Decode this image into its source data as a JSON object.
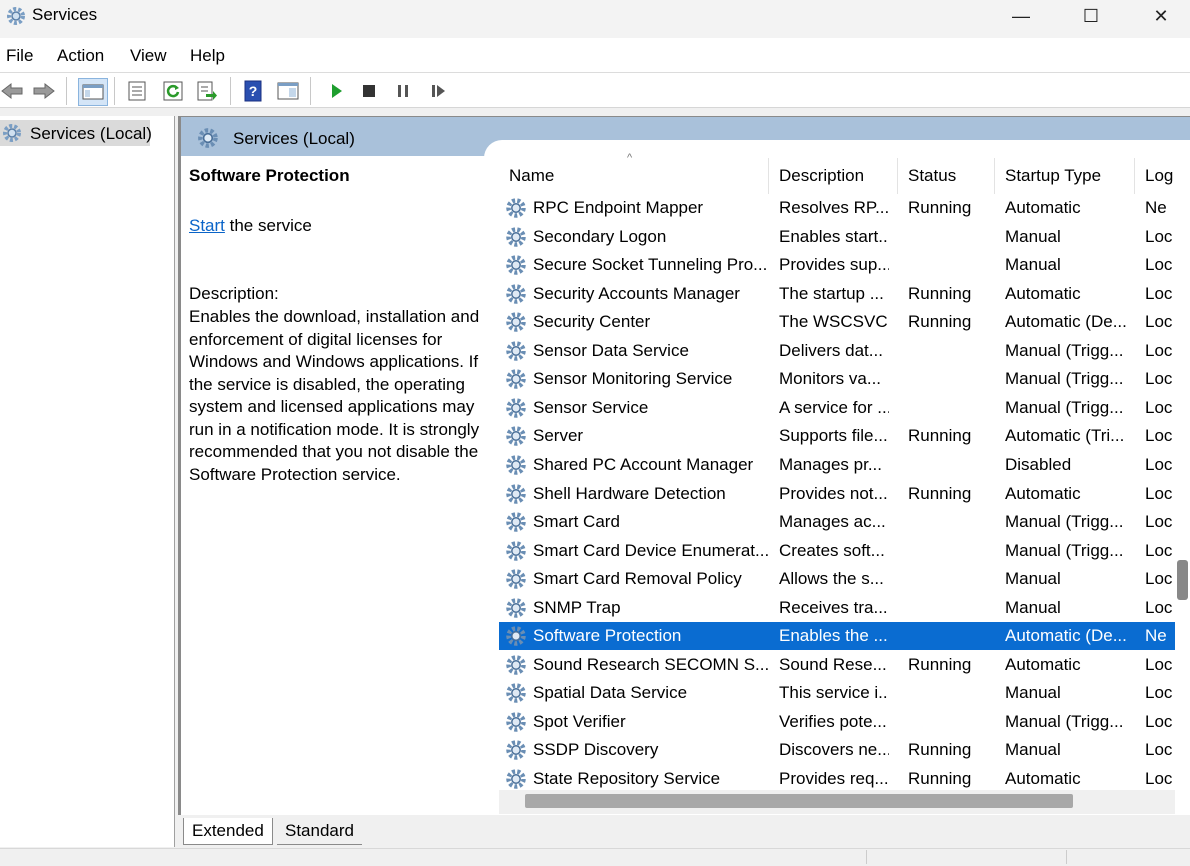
{
  "window": {
    "title": "Services",
    "minimize": "—",
    "maximize": "☐",
    "close": "✕"
  },
  "menu": [
    "File",
    "Action",
    "View",
    "Help"
  ],
  "tree": {
    "item": "Services (Local)"
  },
  "main": {
    "header_title": "Services (Local)"
  },
  "details": {
    "service_name": "Software Protection",
    "start_link": "Start",
    "start_suffix": " the service",
    "description_label": "Description:",
    "description": "Enables the download, installation and enforcement of digital licenses for Windows and Windows applications. If the service is disabled, the operating system and licensed applications may run in a notification mode. It is strongly recommended that you not disable the Software Protection service."
  },
  "columns": [
    "Name",
    "Description",
    "Status",
    "Startup Type",
    "Log"
  ],
  "services": [
    {
      "name": "RPC Endpoint Mapper",
      "description": "Resolves RP...",
      "status": "Running",
      "startup": "Automatic",
      "logon": "Ne"
    },
    {
      "name": "Secondary Logon",
      "description": "Enables start...",
      "status": "",
      "startup": "Manual",
      "logon": "Loc"
    },
    {
      "name": "Secure Socket Tunneling Pro...",
      "description": "Provides sup...",
      "status": "",
      "startup": "Manual",
      "logon": "Loc"
    },
    {
      "name": "Security Accounts Manager",
      "description": "The startup ...",
      "status": "Running",
      "startup": "Automatic",
      "logon": "Loc"
    },
    {
      "name": "Security Center",
      "description": "The WSCSVC...",
      "status": "Running",
      "startup": "Automatic (De...",
      "logon": "Loc"
    },
    {
      "name": "Sensor Data Service",
      "description": "Delivers dat...",
      "status": "",
      "startup": "Manual (Trigg...",
      "logon": "Loc"
    },
    {
      "name": "Sensor Monitoring Service",
      "description": "Monitors va...",
      "status": "",
      "startup": "Manual (Trigg...",
      "logon": "Loc"
    },
    {
      "name": "Sensor Service",
      "description": "A service for ...",
      "status": "",
      "startup": "Manual (Trigg...",
      "logon": "Loc"
    },
    {
      "name": "Server",
      "description": "Supports file...",
      "status": "Running",
      "startup": "Automatic (Tri...",
      "logon": "Loc"
    },
    {
      "name": "Shared PC Account Manager",
      "description": "Manages pr...",
      "status": "",
      "startup": "Disabled",
      "logon": "Loc"
    },
    {
      "name": "Shell Hardware Detection",
      "description": "Provides not...",
      "status": "Running",
      "startup": "Automatic",
      "logon": "Loc"
    },
    {
      "name": "Smart Card",
      "description": "Manages ac...",
      "status": "",
      "startup": "Manual (Trigg...",
      "logon": "Loc"
    },
    {
      "name": "Smart Card Device Enumerat...",
      "description": "Creates soft...",
      "status": "",
      "startup": "Manual (Trigg...",
      "logon": "Loc"
    },
    {
      "name": "Smart Card Removal Policy",
      "description": "Allows the s...",
      "status": "",
      "startup": "Manual",
      "logon": "Loc"
    },
    {
      "name": "SNMP Trap",
      "description": "Receives tra...",
      "status": "",
      "startup": "Manual",
      "logon": "Loc"
    },
    {
      "name": "Software Protection",
      "description": "Enables the ...",
      "status": "",
      "startup": "Automatic (De...",
      "logon": "Ne",
      "selected": true
    },
    {
      "name": "Sound Research SECOMN S...",
      "description": "Sound Rese...",
      "status": "Running",
      "startup": "Automatic",
      "logon": "Loc"
    },
    {
      "name": "Spatial Data Service",
      "description": "This service i...",
      "status": "",
      "startup": "Manual",
      "logon": "Loc"
    },
    {
      "name": "Spot Verifier",
      "description": "Verifies pote...",
      "status": "",
      "startup": "Manual (Trigg...",
      "logon": "Loc"
    },
    {
      "name": "SSDP Discovery",
      "description": "Discovers ne...",
      "status": "Running",
      "startup": "Manual",
      "logon": "Loc"
    },
    {
      "name": "State Repository Service",
      "description": "Provides req...",
      "status": "Running",
      "startup": "Automatic",
      "logon": "Loc"
    }
  ],
  "tabs": [
    "Extended",
    "Standard"
  ],
  "colors": {
    "accent": "#0a6cd1",
    "header": "#a9c1da",
    "link": "#0a64c8"
  },
  "icons": [
    "gear-icon",
    "back-arrow-icon",
    "forward-arrow-icon",
    "console-tree-icon",
    "properties-icon",
    "refresh-icon",
    "export-icon",
    "help-icon",
    "view-icon",
    "play-icon",
    "stop-icon",
    "pause-icon",
    "resume-icon"
  ]
}
